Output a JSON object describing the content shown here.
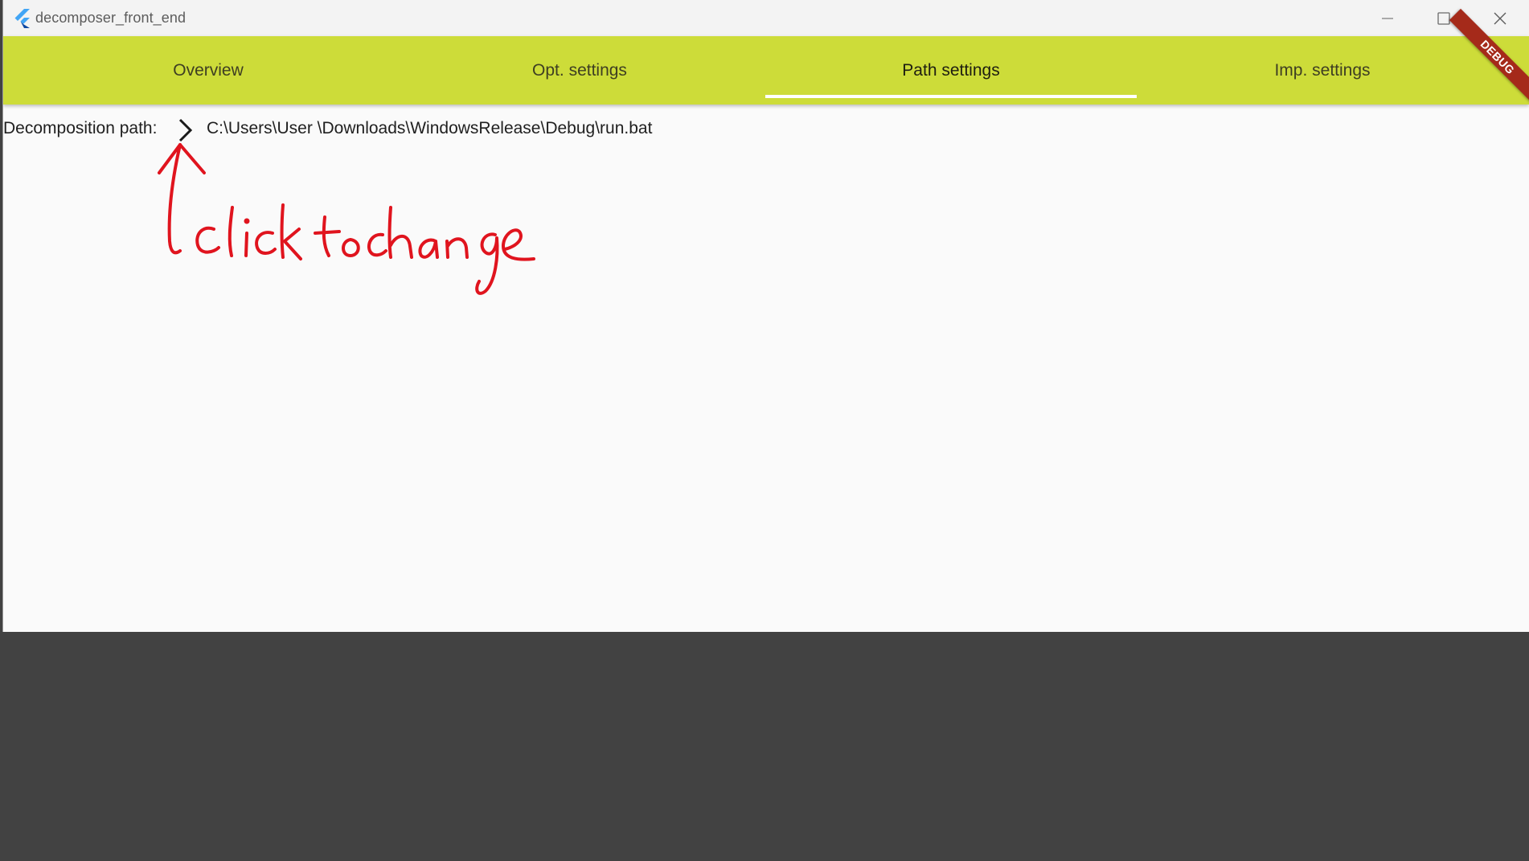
{
  "window": {
    "title": "decomposer_front_end",
    "controls": [
      "minimize-icon",
      "maximize-icon",
      "close-icon"
    ]
  },
  "tabs": [
    {
      "label": "Overview",
      "active": false
    },
    {
      "label": "Opt. settings",
      "active": false
    },
    {
      "label": "Path settings",
      "active": true
    },
    {
      "label": "Imp. settings",
      "active": false
    }
  ],
  "debug_banner": "DEBUG",
  "path_settings": {
    "label": "Decomposition path:",
    "change_icon": "chevron-right-icon",
    "value": "C:\\Users\\User \\Downloads\\WindowsRelease\\Debug\\run.bat"
  },
  "annotation": {
    "text": "click to change",
    "color": "#e0141e"
  },
  "colors": {
    "appbar": "#cddc39",
    "tab_indicator": "#ffffff",
    "debug_banner": "#a52a1a",
    "background": "#424242"
  }
}
